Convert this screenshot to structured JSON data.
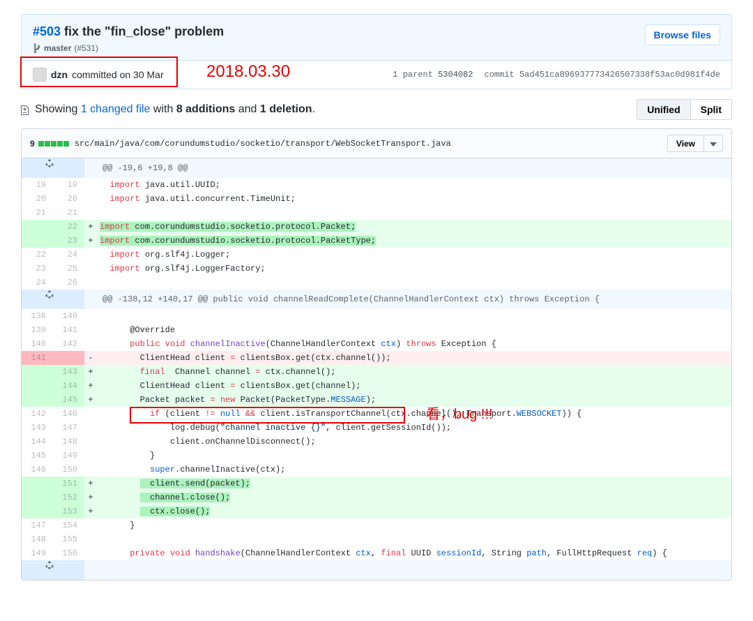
{
  "commit": {
    "issue_num": "#503",
    "title": " fix the \"fin_close\" problem",
    "branch": "master",
    "branch_ref": "(#531)",
    "author": "dzn",
    "committed_text": "committed on 30 Mar",
    "browse_files": "Browse files",
    "parent_label": "1 parent ",
    "parent_hash": "5304082",
    "commit_label": "commit ",
    "commit_hash": "5ad451ca896937773426507338f53ac0d981f4de"
  },
  "annotation": {
    "date": "2018.03.30",
    "bug_text": "看，bug !!!"
  },
  "toc": {
    "showing": "Showing ",
    "changed": "1 changed file",
    "with": " with ",
    "additions": "8 additions",
    "and": " and ",
    "deletions": "1 deletion",
    "period": "."
  },
  "view_toggle": {
    "unified": "Unified",
    "split": "Split"
  },
  "file": {
    "diff_count": "9",
    "path": "src/main/java/com/corundumstudio/socketio/transport/WebSocketTransport.java",
    "view": "View"
  },
  "hunks": {
    "h1": "@@ -19,6 +19,8 @@",
    "h2": "@@ -138,12 +140,17 @@ public void channelReadComplete(ChannelHandlerContext ctx) throws Exception {"
  },
  "lines": {
    "l19a": "19",
    "l19b": "19",
    "c19": "import java.util.UUID;",
    "l20a": "20",
    "l20b": "20",
    "c20": "import java.util.concurrent.TimeUnit;",
    "l21a": "21",
    "l21b": "21",
    "c21": "",
    "l22b": "22",
    "c22add": "import com.corundumstudio.socketio.protocol.Packet;",
    "l23b": "23",
    "c23add": "import com.corundumstudio.socketio.protocol.PacketType;",
    "l22a": "22",
    "l24b": "24",
    "c24": "import org.slf4j.Logger;",
    "l23a": "23",
    "l25b": "25",
    "c25": "import org.slf4j.LoggerFactory;",
    "l24a": "24",
    "l26b": "26",
    "c26": "",
    "l138a": "138",
    "l140b": "140",
    "c140": "",
    "l139a": "139",
    "l141b": "141",
    "l140a": "140",
    "l142b": "142",
    "l141a": "141",
    "l143b": "143",
    "l144b": "144",
    "l145b": "145",
    "l142a": "142",
    "l146b": "146",
    "l143a": "143",
    "l147b": "147",
    "l144a": "144",
    "l148b": "148",
    "l145a": "145",
    "l149b": "149",
    "l146a": "146",
    "l150b": "150",
    "l151b": "151",
    "l152b": "152",
    "l153b": "153",
    "l147a": "147",
    "l154b": "154",
    "l148a": "148",
    "l155b": "155",
    "l149a": "149",
    "l156b": "156"
  }
}
